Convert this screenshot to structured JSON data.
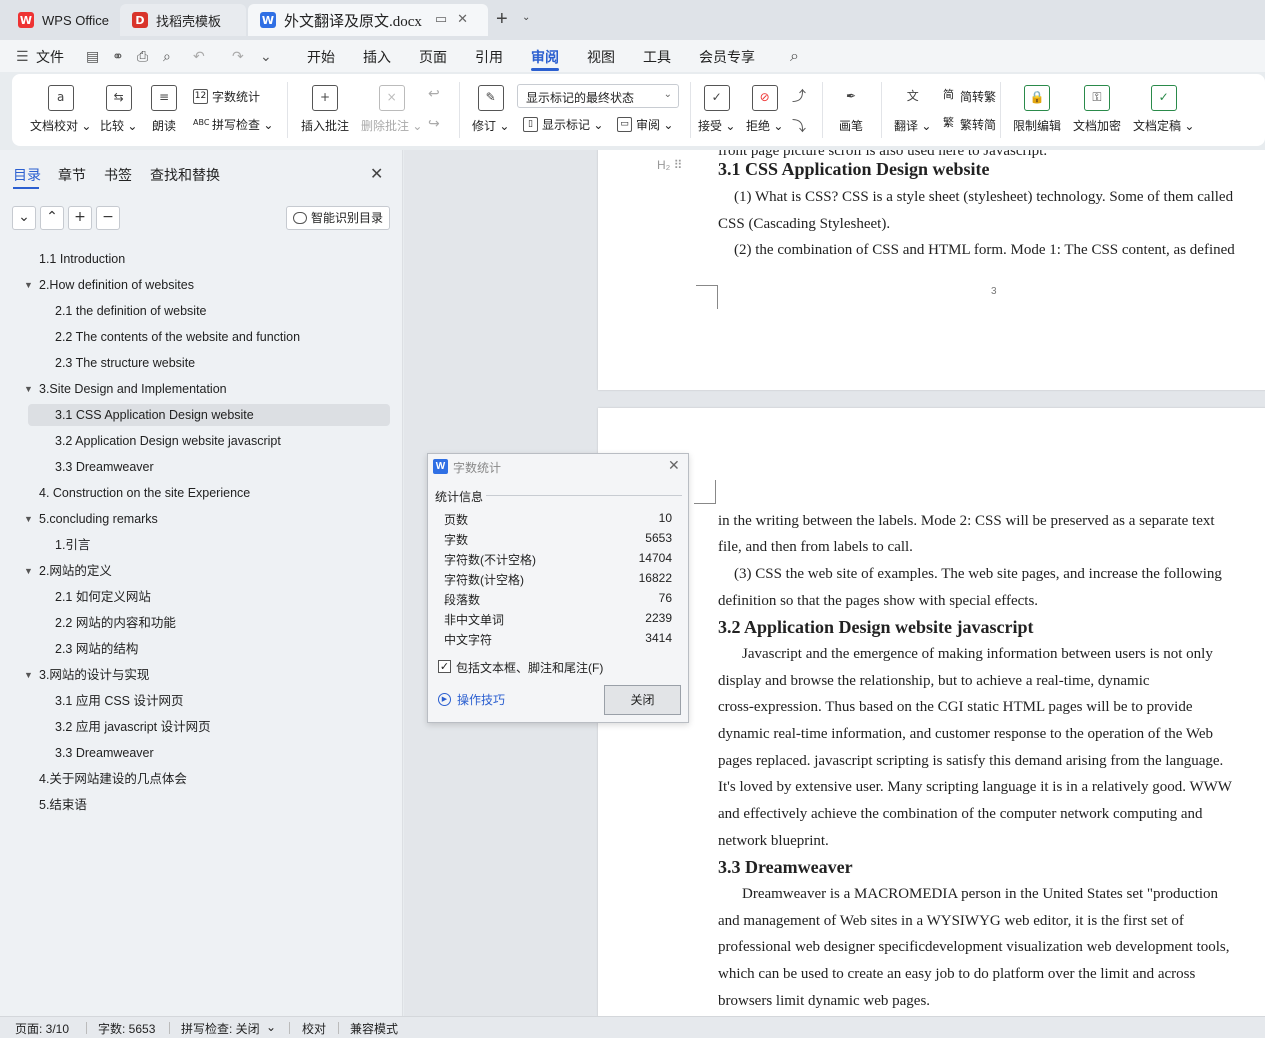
{
  "tabs": [
    {
      "label": "WPS Office"
    },
    {
      "label": "找稻壳模板"
    },
    {
      "label": "外文翻译及原文.docx"
    }
  ],
  "menubar": {
    "file": "文件",
    "items": [
      "开始",
      "插入",
      "页面",
      "引用",
      "审阅",
      "视图",
      "工具",
      "会员专享"
    ],
    "active": "审阅"
  },
  "ribbon": {
    "proofread": "文档校对",
    "compare": "比较",
    "read_aloud": "朗读",
    "word_count": "字数统计",
    "spell_check": "拼写检查",
    "insert_comment": "插入批注",
    "delete_comment": "删除批注",
    "revise": "修订",
    "markup_state": "显示标记的最终状态",
    "show_markup": "显示标记",
    "review": "审阅",
    "accept": "接受",
    "reject": "拒绝",
    "pen": "画笔",
    "translate": "翻译",
    "to_traditional": "简转繁",
    "to_simplified": "繁转简",
    "restrict_edit": "限制编辑",
    "encrypt": "文档加密",
    "finalize": "文档定稿"
  },
  "nav": {
    "tabs": [
      "目录",
      "章节",
      "书签",
      "查找和替换"
    ],
    "smart_btn": "智能识别目录",
    "toc": [
      {
        "label": "1.1 Introduction"
      },
      {
        "label": "2.How definition of websites"
      },
      {
        "label": "2.1 the definition of website"
      },
      {
        "label": "2.2 The contents of the website and function"
      },
      {
        "label": "2.3 The structure website"
      },
      {
        "label": "3.Site Design and Implementation"
      },
      {
        "label": "3.1 CSS Application Design website"
      },
      {
        "label": "3.2 Application Design website javascript"
      },
      {
        "label": "3.3 Dreamweaver"
      },
      {
        "label": "4. Construction on the site Experience"
      },
      {
        "label": "5.concluding remarks"
      },
      {
        "label": "1.引言"
      },
      {
        "label": "2.网站的定义"
      },
      {
        "label": "2.1  如何定义网站"
      },
      {
        "label": "2.2  网站的内容和功能"
      },
      {
        "label": "2.3  网站的结构"
      },
      {
        "label": "3.网站的设计与实现"
      },
      {
        "label": "3.1  应用 CSS  设计网页"
      },
      {
        "label": "3.2  应用 javascript  设计网页"
      },
      {
        "label": "3.3 Dreamweaver"
      },
      {
        "label": "4.关于网站建设的几点体会"
      },
      {
        "label": "5.结束语"
      }
    ]
  },
  "document": {
    "page1": {
      "line0": "front page picture scroll is also used here to Javascript.",
      "heading": "3.1 CSS Application Design website",
      "lines": [
        "(1) What is CSS? CSS is a style sheet (stylesheet) technology. Some of them called",
        "CSS (Cascading Stylesheet).",
        "(2) the combination of CSS and HTML form. Mode 1: The CSS content, as defined"
      ],
      "page_number": "3"
    },
    "page2": {
      "lines_a": [
        "in the writing between the labels. Mode 2: CSS will be preserved as a separate text",
        "file, and then from labels to call.",
        "(3) CSS the web site of examples. The web site pages, and increase the following",
        "definition so that the pages show with special effects."
      ],
      "heading2": "3.2 Application Design website javascript",
      "lines_b": [
        "Javascript and the emergence of making information between users is not only",
        "display  and  browse  the  relationship,  but  to  achieve  a  real-time,  dynamic",
        "cross-expression. Thus based on the CGI static HTML pages will be to provide",
        "dynamic real-time information, and customer response to the operation of the Web",
        "pages replaced. javascript scripting is satisfy this demand arising from the language.",
        "It's loved by extensive user. Many scripting language it is in a relatively good. WWW",
        "and effectively achieve the combination of the computer network computing and",
        "network blueprint."
      ],
      "heading3": "3.3 Dreamweaver",
      "lines_c": [
        "Dreamweaver is a MACROMEDIA person in the United States set \"production",
        "and management of Web sites in a WYSIWYG web editor, it is the first set of",
        "professional web designer specificdevelopment visualization web development tools,",
        "which can be used to create an easy job to do platform over the limit and across",
        "browsers limit dynamic web pages."
      ]
    }
  },
  "word_count_dialog": {
    "title": "字数统计",
    "section": "统计信息",
    "stats": [
      {
        "label": "页数",
        "value": "10"
      },
      {
        "label": "字数",
        "value": "5653"
      },
      {
        "label": "字符数(不计空格)",
        "value": "14704"
      },
      {
        "label": "字符数(计空格)",
        "value": "16822"
      },
      {
        "label": "段落数",
        "value": "76"
      },
      {
        "label": "非中文单词",
        "value": "2239"
      },
      {
        "label": "中文字符",
        "value": "3414"
      }
    ],
    "include_label": "包括文本框、脚注和尾注(F)",
    "tips": "操作技巧",
    "close": "关闭"
  },
  "statusbar": {
    "page": "页面: 3/10",
    "words": "字数: 5653",
    "spell": "拼写检查: 关闭",
    "proof": "校对",
    "compat": "兼容模式"
  },
  "colors": {
    "accent": "#2b5fd0",
    "wps_red": "#e33333",
    "word_blue": "#2f6fe4"
  }
}
